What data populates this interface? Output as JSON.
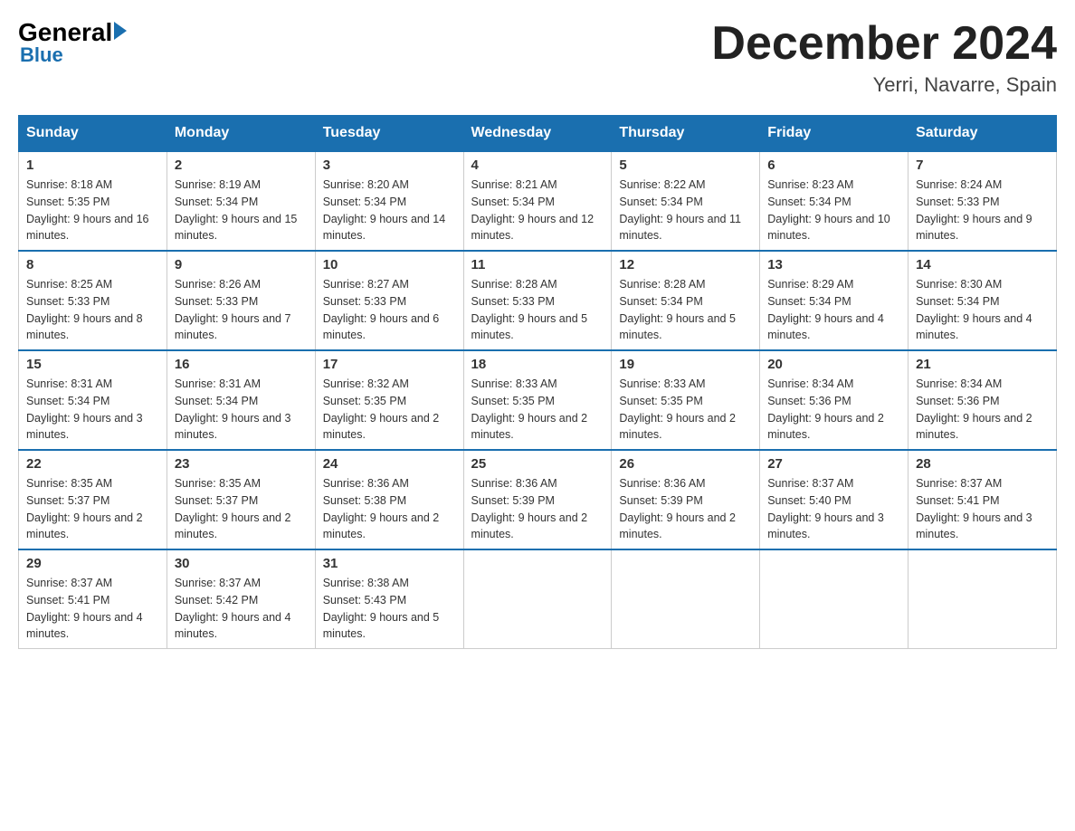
{
  "logo": {
    "main_text": "General",
    "sub_text": "Blue"
  },
  "title": "December 2024",
  "subtitle": "Yerri, Navarre, Spain",
  "days": [
    "Sunday",
    "Monday",
    "Tuesday",
    "Wednesday",
    "Thursday",
    "Friday",
    "Saturday"
  ],
  "weeks": [
    [
      {
        "num": "1",
        "sunrise": "8:18 AM",
        "sunset": "5:35 PM",
        "daylight": "9 hours and 16 minutes."
      },
      {
        "num": "2",
        "sunrise": "8:19 AM",
        "sunset": "5:34 PM",
        "daylight": "9 hours and 15 minutes."
      },
      {
        "num": "3",
        "sunrise": "8:20 AM",
        "sunset": "5:34 PM",
        "daylight": "9 hours and 14 minutes."
      },
      {
        "num": "4",
        "sunrise": "8:21 AM",
        "sunset": "5:34 PM",
        "daylight": "9 hours and 12 minutes."
      },
      {
        "num": "5",
        "sunrise": "8:22 AM",
        "sunset": "5:34 PM",
        "daylight": "9 hours and 11 minutes."
      },
      {
        "num": "6",
        "sunrise": "8:23 AM",
        "sunset": "5:34 PM",
        "daylight": "9 hours and 10 minutes."
      },
      {
        "num": "7",
        "sunrise": "8:24 AM",
        "sunset": "5:33 PM",
        "daylight": "9 hours and 9 minutes."
      }
    ],
    [
      {
        "num": "8",
        "sunrise": "8:25 AM",
        "sunset": "5:33 PM",
        "daylight": "9 hours and 8 minutes."
      },
      {
        "num": "9",
        "sunrise": "8:26 AM",
        "sunset": "5:33 PM",
        "daylight": "9 hours and 7 minutes."
      },
      {
        "num": "10",
        "sunrise": "8:27 AM",
        "sunset": "5:33 PM",
        "daylight": "9 hours and 6 minutes."
      },
      {
        "num": "11",
        "sunrise": "8:28 AM",
        "sunset": "5:33 PM",
        "daylight": "9 hours and 5 minutes."
      },
      {
        "num": "12",
        "sunrise": "8:28 AM",
        "sunset": "5:34 PM",
        "daylight": "9 hours and 5 minutes."
      },
      {
        "num": "13",
        "sunrise": "8:29 AM",
        "sunset": "5:34 PM",
        "daylight": "9 hours and 4 minutes."
      },
      {
        "num": "14",
        "sunrise": "8:30 AM",
        "sunset": "5:34 PM",
        "daylight": "9 hours and 4 minutes."
      }
    ],
    [
      {
        "num": "15",
        "sunrise": "8:31 AM",
        "sunset": "5:34 PM",
        "daylight": "9 hours and 3 minutes."
      },
      {
        "num": "16",
        "sunrise": "8:31 AM",
        "sunset": "5:34 PM",
        "daylight": "9 hours and 3 minutes."
      },
      {
        "num": "17",
        "sunrise": "8:32 AM",
        "sunset": "5:35 PM",
        "daylight": "9 hours and 2 minutes."
      },
      {
        "num": "18",
        "sunrise": "8:33 AM",
        "sunset": "5:35 PM",
        "daylight": "9 hours and 2 minutes."
      },
      {
        "num": "19",
        "sunrise": "8:33 AM",
        "sunset": "5:35 PM",
        "daylight": "9 hours and 2 minutes."
      },
      {
        "num": "20",
        "sunrise": "8:34 AM",
        "sunset": "5:36 PM",
        "daylight": "9 hours and 2 minutes."
      },
      {
        "num": "21",
        "sunrise": "8:34 AM",
        "sunset": "5:36 PM",
        "daylight": "9 hours and 2 minutes."
      }
    ],
    [
      {
        "num": "22",
        "sunrise": "8:35 AM",
        "sunset": "5:37 PM",
        "daylight": "9 hours and 2 minutes."
      },
      {
        "num": "23",
        "sunrise": "8:35 AM",
        "sunset": "5:37 PM",
        "daylight": "9 hours and 2 minutes."
      },
      {
        "num": "24",
        "sunrise": "8:36 AM",
        "sunset": "5:38 PM",
        "daylight": "9 hours and 2 minutes."
      },
      {
        "num": "25",
        "sunrise": "8:36 AM",
        "sunset": "5:39 PM",
        "daylight": "9 hours and 2 minutes."
      },
      {
        "num": "26",
        "sunrise": "8:36 AM",
        "sunset": "5:39 PM",
        "daylight": "9 hours and 2 minutes."
      },
      {
        "num": "27",
        "sunrise": "8:37 AM",
        "sunset": "5:40 PM",
        "daylight": "9 hours and 3 minutes."
      },
      {
        "num": "28",
        "sunrise": "8:37 AM",
        "sunset": "5:41 PM",
        "daylight": "9 hours and 3 minutes."
      }
    ],
    [
      {
        "num": "29",
        "sunrise": "8:37 AM",
        "sunset": "5:41 PM",
        "daylight": "9 hours and 4 minutes."
      },
      {
        "num": "30",
        "sunrise": "8:37 AM",
        "sunset": "5:42 PM",
        "daylight": "9 hours and 4 minutes."
      },
      {
        "num": "31",
        "sunrise": "8:38 AM",
        "sunset": "5:43 PM",
        "daylight": "9 hours and 5 minutes."
      },
      null,
      null,
      null,
      null
    ]
  ]
}
